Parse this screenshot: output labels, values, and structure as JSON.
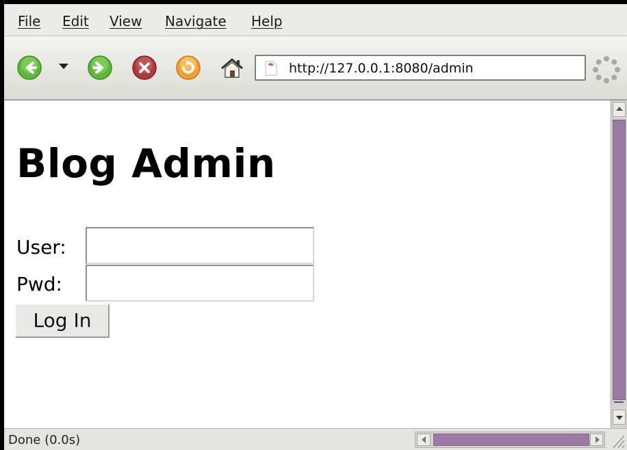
{
  "menubar": {
    "items": [
      {
        "label": "File"
      },
      {
        "label": "Edit"
      },
      {
        "label": "View"
      },
      {
        "label": "Navigate"
      },
      {
        "label": "Help"
      }
    ]
  },
  "toolbar": {
    "back_icon": "back-arrow-icon",
    "history_icon": "history-dropdown-icon",
    "forward_icon": "forward-arrow-icon",
    "stop_icon": "stop-icon",
    "reload_icon": "reload-icon",
    "home_icon": "home-icon",
    "url": "http://127.0.0.1:8080/admin",
    "throbber_icon": "loading-throbber-icon"
  },
  "page": {
    "title": "Blog Admin",
    "user_label": "User:",
    "user_value": "",
    "pwd_label": "Pwd:",
    "pwd_value": "",
    "login_label": "Log In"
  },
  "status": {
    "text": "Done (0.0s)"
  },
  "colors": {
    "scrollbar_thumb": "#9c7aa3",
    "back_forward": "#5cb83a",
    "stop": "#b03a3a",
    "reload": "#f0a030"
  }
}
